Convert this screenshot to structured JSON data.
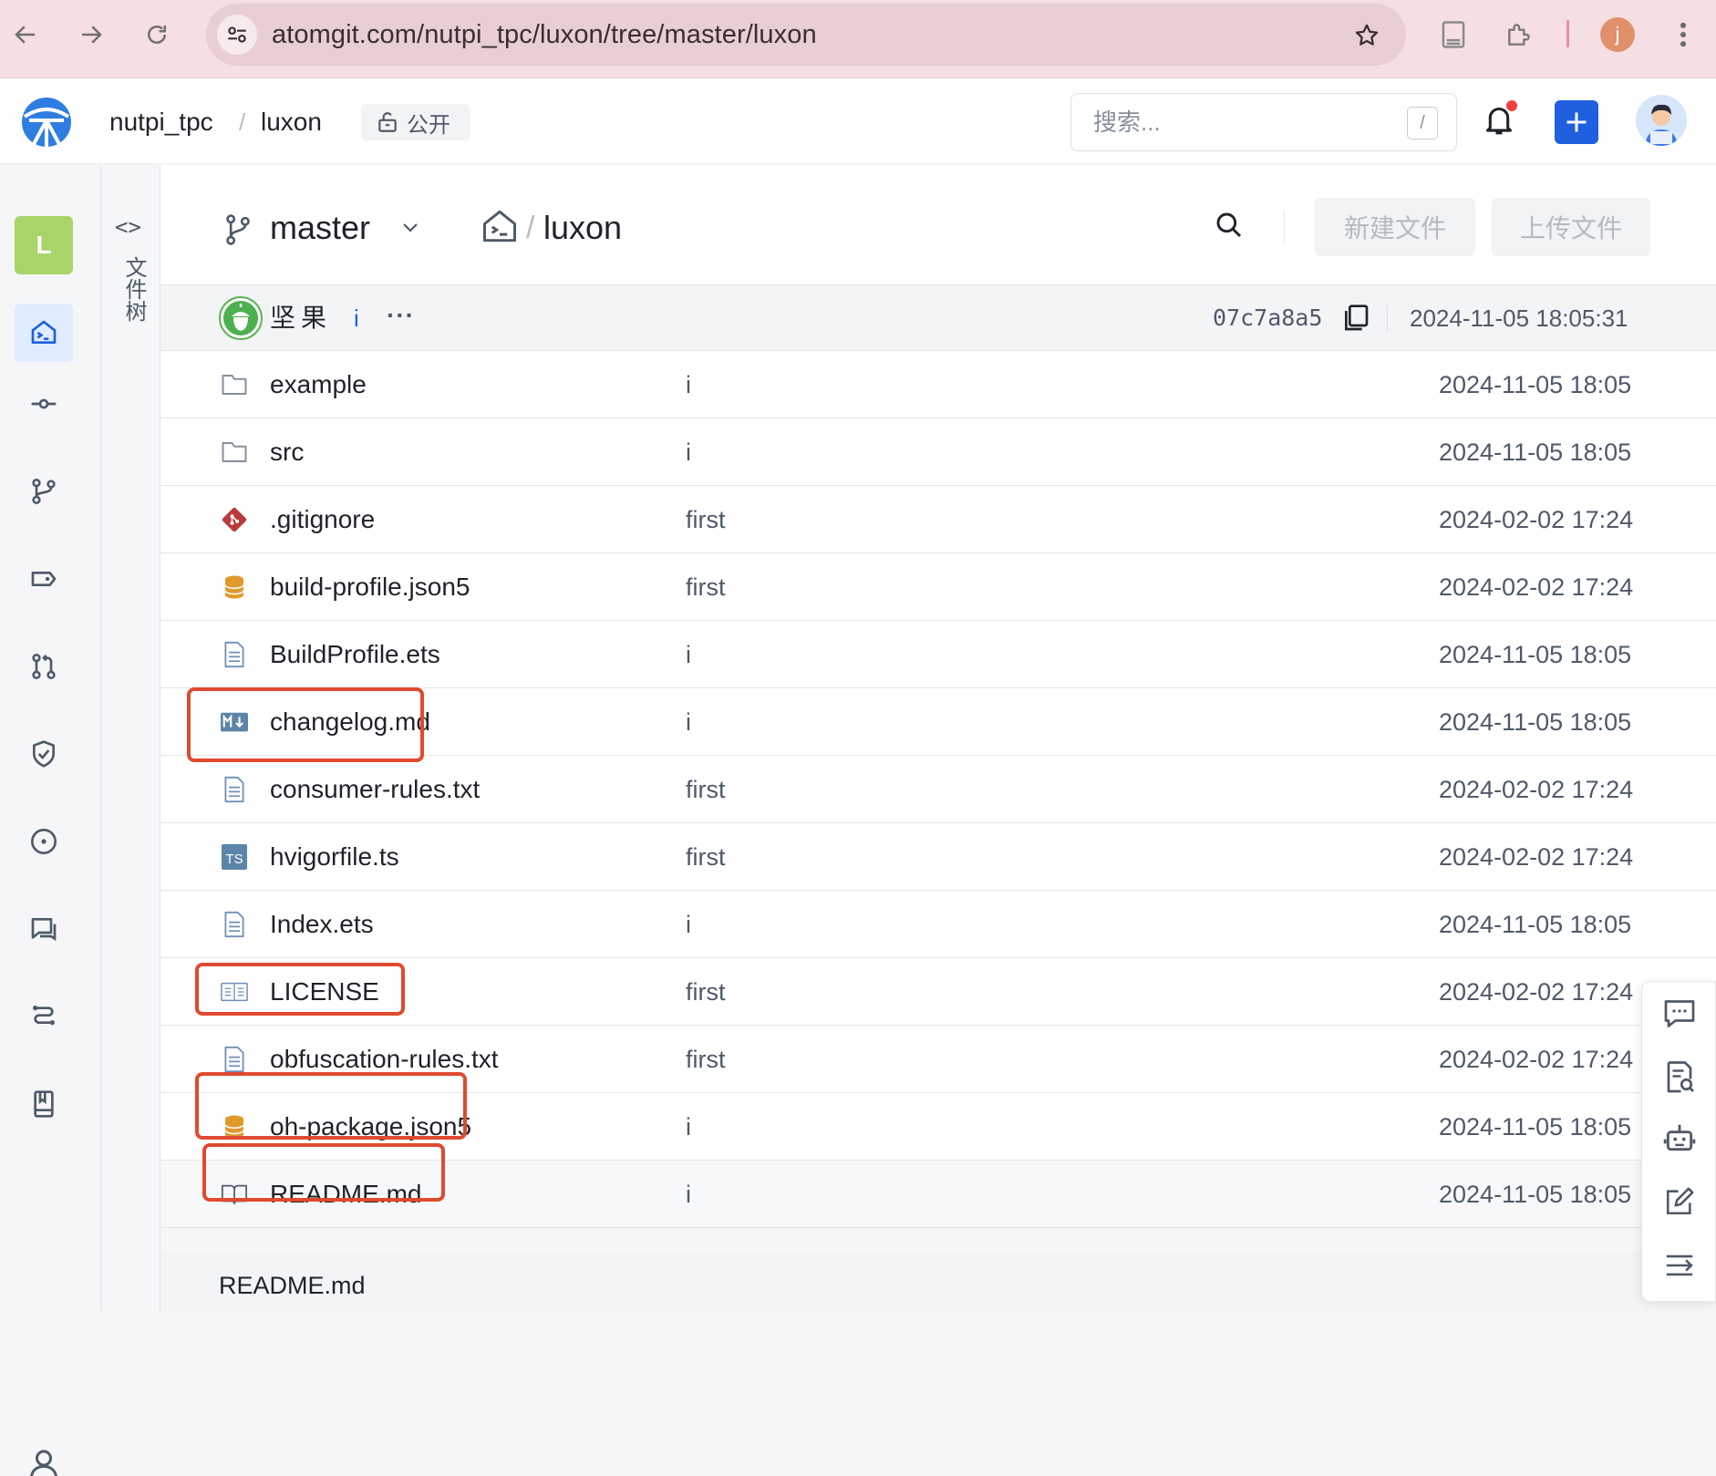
{
  "browser": {
    "url": "atomgit.com/nutpi_tpc/luxon/tree/master/luxon",
    "profile_initial": "j"
  },
  "header": {
    "owner": "nutpi_tpc",
    "separator": "/",
    "repo": "luxon",
    "visibility": "公开",
    "search_placeholder": "搜索...",
    "search_shortcut": "/"
  },
  "sidebar": {
    "project_letter": "L",
    "items": [
      "home-icon",
      "commit-icon",
      "branch-icon",
      "tag-icon",
      "merge-request-icon",
      "shield-icon",
      "issue-icon",
      "discussion-icon",
      "pipeline-icon",
      "wiki-icon"
    ]
  },
  "file_tree": {
    "toggle": "<>",
    "label": "文件树"
  },
  "toolbar": {
    "branch": "master",
    "path_separator": "/",
    "path": "luxon",
    "new_file": "新建文件",
    "upload_file": "上传文件"
  },
  "commit": {
    "author": "坚果",
    "message": "i",
    "more": "···",
    "hash": "07c7a8a5",
    "date": "2024-11-05 18:05:31"
  },
  "files": [
    {
      "name": "example",
      "icon": "folder-icon",
      "message": "i",
      "date": "2024-11-05 18:05"
    },
    {
      "name": "src",
      "icon": "folder-icon",
      "message": "i",
      "date": "2024-11-05 18:05"
    },
    {
      "name": ".gitignore",
      "icon": "git-icon",
      "message": "first",
      "date": "2024-02-02 17:24"
    },
    {
      "name": "build-profile.json5",
      "icon": "database-icon",
      "message": "first",
      "date": "2024-02-02 17:24"
    },
    {
      "name": "BuildProfile.ets",
      "icon": "file-icon",
      "message": "i",
      "date": "2024-11-05 18:05"
    },
    {
      "name": "changelog.md",
      "icon": "markdown-icon",
      "message": "i",
      "date": "2024-11-05 18:05"
    },
    {
      "name": "consumer-rules.txt",
      "icon": "file-icon",
      "message": "first",
      "date": "2024-02-02 17:24"
    },
    {
      "name": "hvigorfile.ts",
      "icon": "typescript-icon",
      "message": "first",
      "date": "2024-02-02 17:24"
    },
    {
      "name": "Index.ets",
      "icon": "file-icon",
      "message": "i",
      "date": "2024-11-05 18:05"
    },
    {
      "name": "LICENSE",
      "icon": "license-icon",
      "message": "first",
      "date": "2024-02-02 17:24"
    },
    {
      "name": "obfuscation-rules.txt",
      "icon": "file-icon",
      "message": "first",
      "date": "2024-02-02 17:24"
    },
    {
      "name": "oh-package.json5",
      "icon": "database-icon",
      "message": "i",
      "date": "2024-11-05 18:05"
    },
    {
      "name": "README.md",
      "icon": "book-icon",
      "message": "i",
      "date": "2024-11-05 18:05"
    }
  ],
  "readme": {
    "title": "README.md"
  },
  "float_tools": [
    "chat-icon",
    "doc-search-icon",
    "robot-icon",
    "edit-icon",
    "collapse-icon"
  ],
  "colors": {
    "accent": "#1f5fe0",
    "highlight": "#e04a2f",
    "chrome": "#f6dfe3"
  }
}
